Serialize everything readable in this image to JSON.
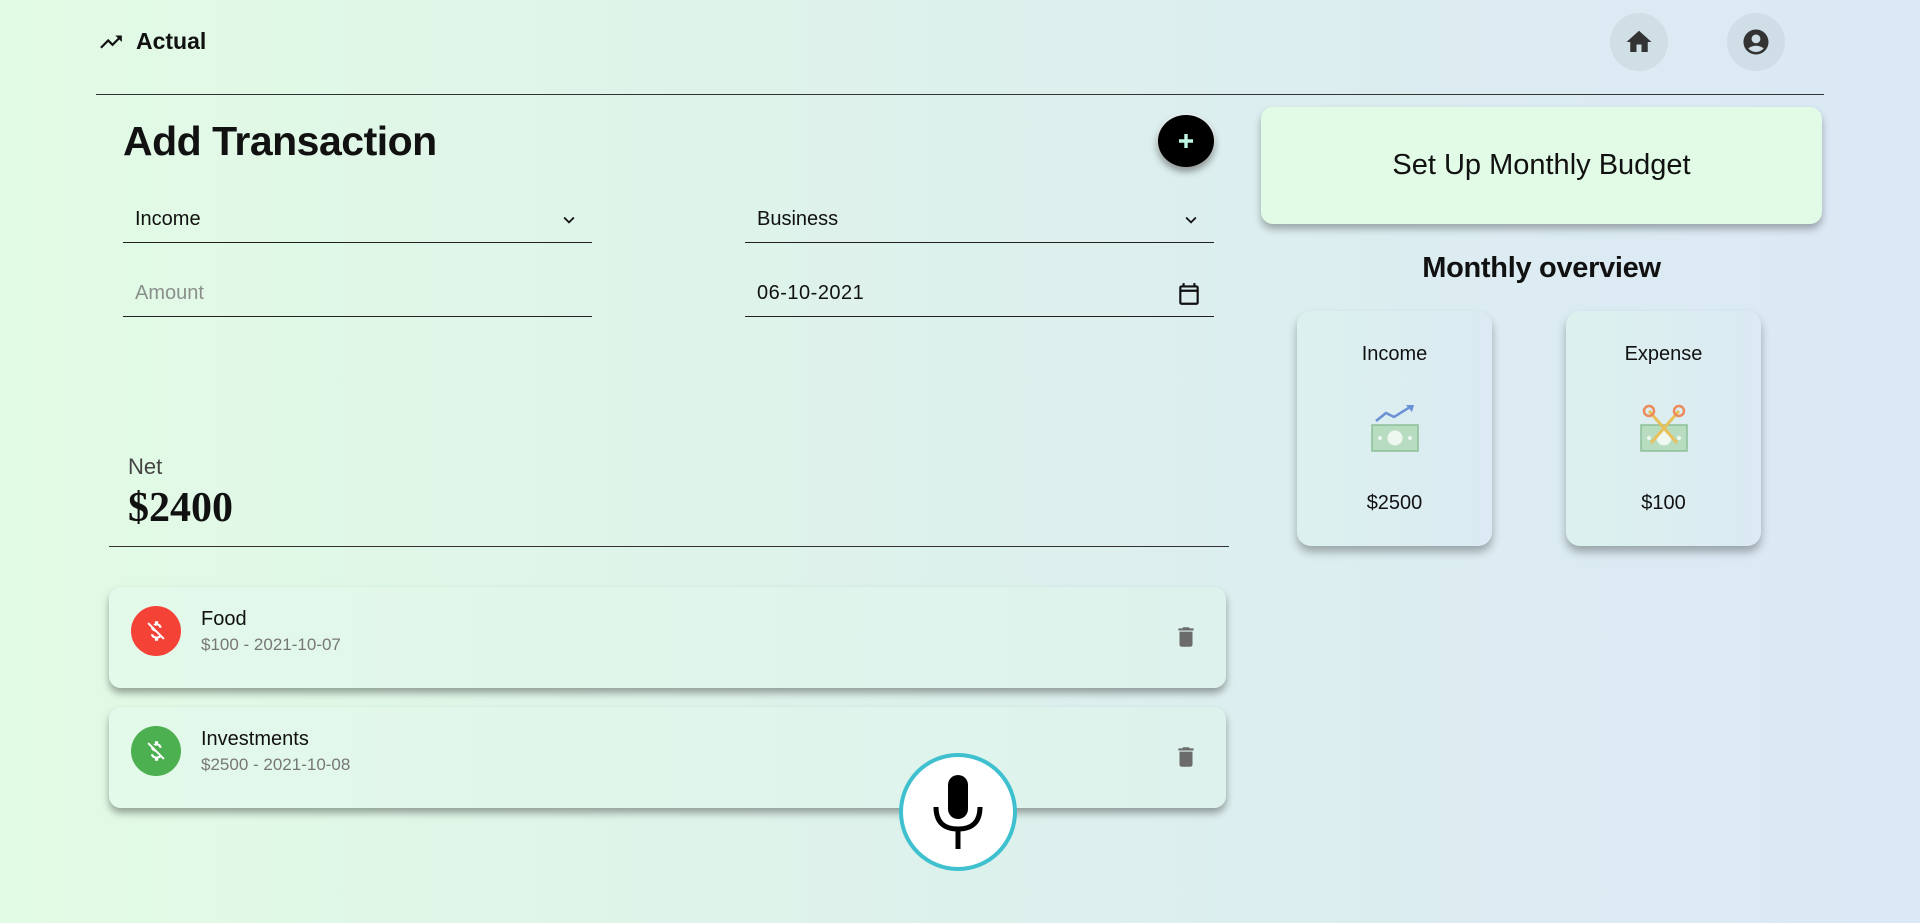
{
  "header": {
    "brand": "Actual",
    "brand_icon": "trending-up-icon",
    "home_icon": "home-icon",
    "account_icon": "account-circle-icon"
  },
  "add_transaction": {
    "title": "Add Transaction",
    "add_button_icon": "plus-icon",
    "type_value": "Income",
    "category_value": "Business",
    "amount_placeholder": "Amount",
    "date_value": "06-10-2021"
  },
  "net": {
    "label": "Net",
    "value": "$2400"
  },
  "transactions": [
    {
      "title": "Food",
      "subtitle": "$100 - 2021-10-07",
      "kind": "expense",
      "color": "#f44336"
    },
    {
      "title": "Investments",
      "subtitle": "$2500 - 2021-10-08",
      "kind": "income",
      "color": "#4caf50"
    }
  ],
  "budget": {
    "button_label": "Set Up Monthly Budget"
  },
  "overview": {
    "title": "Monthly overview",
    "cards": [
      {
        "label": "Income",
        "value": "$2500",
        "icon": "money-growth-icon"
      },
      {
        "label": "Expense",
        "value": "$100",
        "icon": "money-cut-icon"
      }
    ]
  },
  "mic": {
    "icon": "microphone-icon"
  },
  "colors": {
    "expense": "#f44336",
    "income": "#4caf50",
    "budget_bg": "#e1fbe6",
    "mic_border": "#3fc0cf"
  }
}
